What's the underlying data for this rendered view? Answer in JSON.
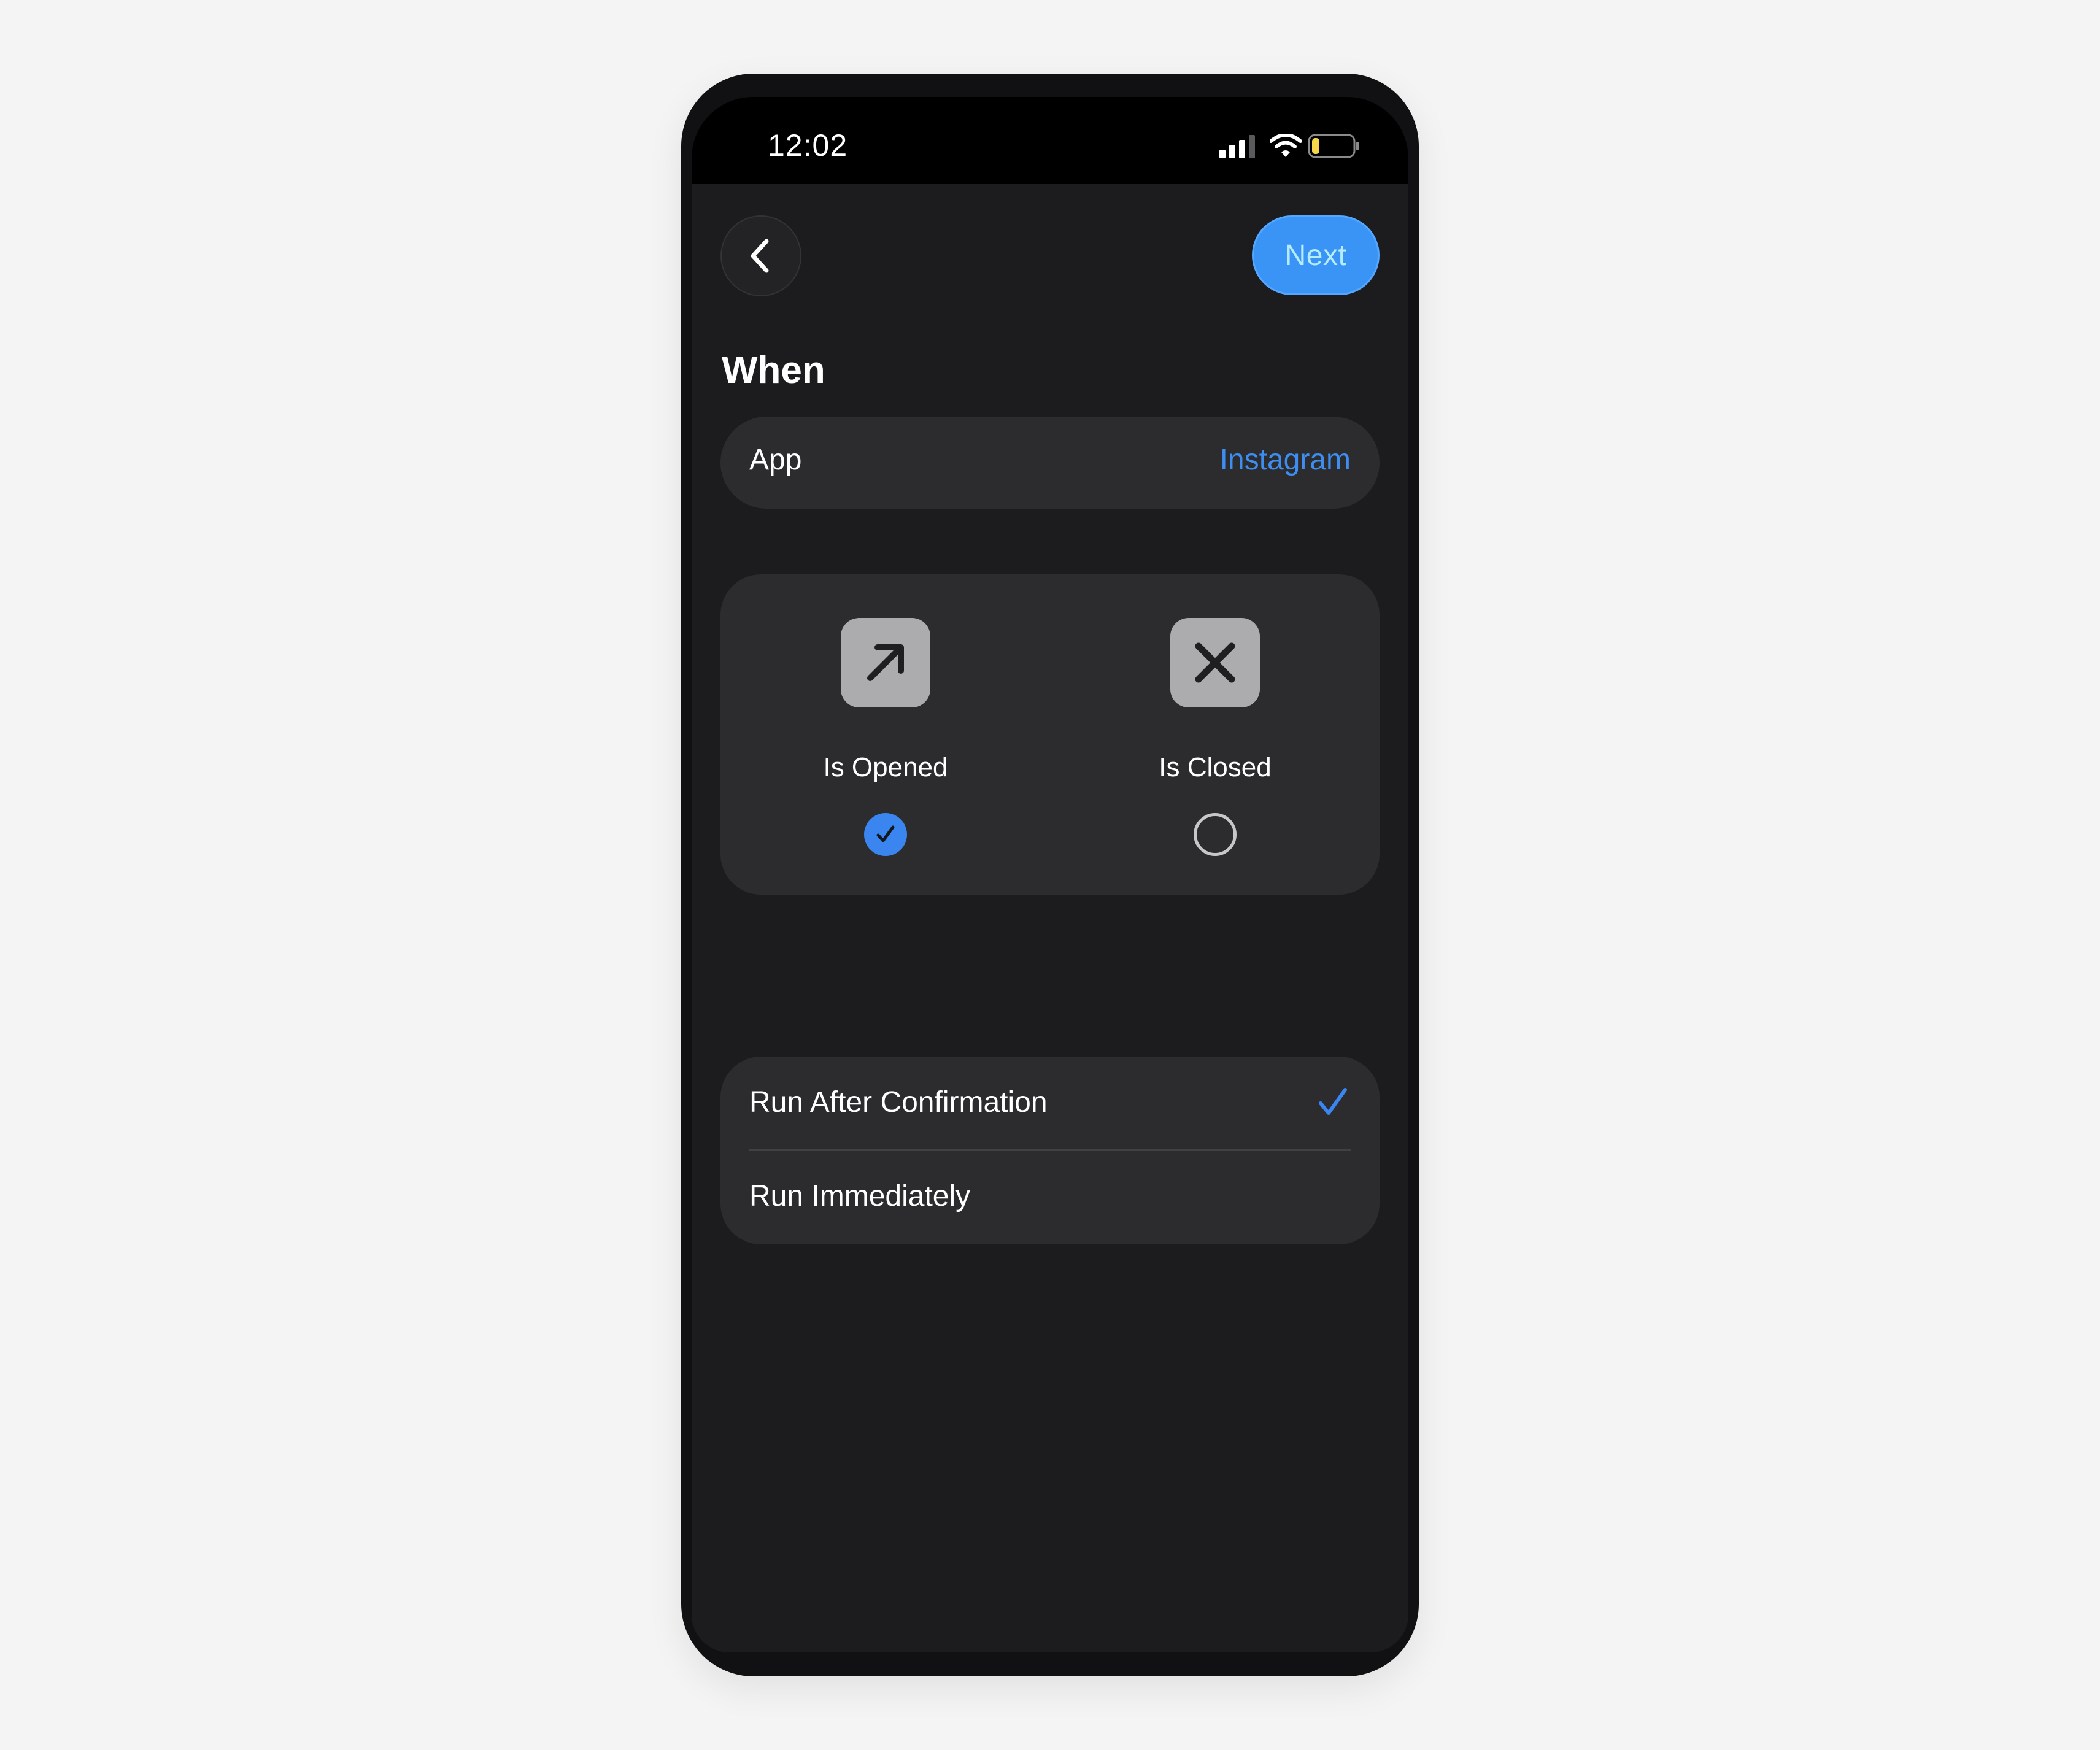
{
  "status_bar": {
    "time": "12:02",
    "icons": [
      "cellular-signal-icon",
      "wifi-icon",
      "battery-icon"
    ],
    "battery_level": 0.15,
    "battery_color": "#f6d64a"
  },
  "nav": {
    "back_icon": "chevron-left-icon",
    "next_label": "Next"
  },
  "section": {
    "title": "When"
  },
  "app_row": {
    "label": "App",
    "value": "Instagram"
  },
  "states": [
    {
      "icon": "arrow-up-right-icon",
      "label": "Is Opened",
      "selected": true
    },
    {
      "icon": "x-mark-icon",
      "label": "Is Closed",
      "selected": false
    }
  ],
  "run_options": [
    {
      "label": "Run After Confirmation",
      "checked": true
    },
    {
      "label": "Run Immediately",
      "checked": false
    }
  ],
  "colors": {
    "accent": "#3a85ef",
    "link": "#3d8ef0",
    "background": "#1c1c1e",
    "card": "#2c2c2e"
  }
}
